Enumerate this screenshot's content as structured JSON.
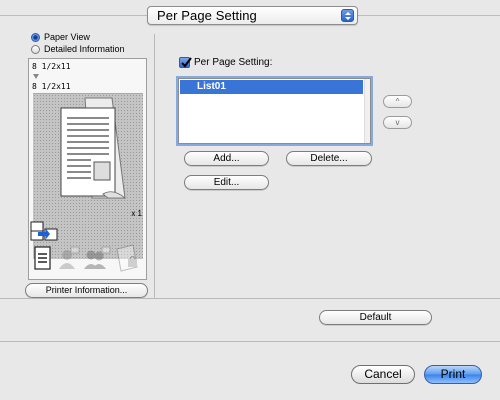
{
  "header": {
    "popup_value": "Per Page Setting"
  },
  "left_panel": {
    "view_options": [
      {
        "label": "Paper View",
        "selected": true
      },
      {
        "label": "Detailed Information",
        "selected": false
      }
    ],
    "preview": {
      "input_size": "8 1/2x11",
      "output_size": "8 1/2x11",
      "copies": "x 1"
    },
    "printer_info_button": "Printer Information..."
  },
  "right_panel": {
    "per_page_setting": {
      "label": "Per Page Setting:",
      "checked": true
    },
    "list_items": [
      "List01"
    ],
    "selected_item": "List01",
    "up_label": "^",
    "down_label": "v",
    "add_button": "Add...",
    "delete_button": "Delete...",
    "edit_button": "Edit..."
  },
  "footer": {
    "default_button": "Default",
    "cancel_button": "Cancel",
    "print_button": "Print"
  },
  "colors": {
    "selection": "#3875d7",
    "background": "#e8e8e8",
    "print_button": "#5c9cf0"
  }
}
